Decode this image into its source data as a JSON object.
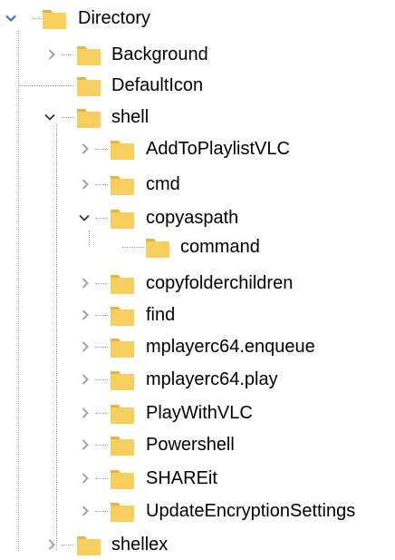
{
  "tree": {
    "nodes": [
      {
        "label": "Directory",
        "state": "expanded",
        "icon": "folder-icon"
      },
      {
        "label": "Background",
        "state": "collapsed",
        "icon": "folder-icon"
      },
      {
        "label": "DefaultIcon",
        "state": "leaf",
        "icon": "folder-icon"
      },
      {
        "label": "shell",
        "state": "expanded",
        "icon": "folder-icon"
      },
      {
        "label": "AddToPlaylistVLC",
        "state": "collapsed",
        "icon": "folder-icon"
      },
      {
        "label": "cmd",
        "state": "collapsed",
        "icon": "folder-icon"
      },
      {
        "label": "copyaspath",
        "state": "expanded",
        "icon": "folder-icon"
      },
      {
        "label": "command",
        "state": "leaf",
        "icon": "folder-icon"
      },
      {
        "label": "copyfolderchildren",
        "state": "collapsed",
        "icon": "folder-icon"
      },
      {
        "label": "find",
        "state": "collapsed",
        "icon": "folder-icon"
      },
      {
        "label": "mplayerc64.enqueue",
        "state": "collapsed",
        "icon": "folder-icon"
      },
      {
        "label": "mplayerc64.play",
        "state": "collapsed",
        "icon": "folder-icon"
      },
      {
        "label": "PlayWithVLC",
        "state": "collapsed",
        "icon": "folder-icon"
      },
      {
        "label": "Powershell",
        "state": "collapsed",
        "icon": "folder-icon"
      },
      {
        "label": "SHAREit",
        "state": "collapsed",
        "icon": "folder-icon"
      },
      {
        "label": "UpdateEncryptionSettings",
        "state": "collapsed",
        "icon": "folder-icon"
      },
      {
        "label": "shellex",
        "state": "collapsed",
        "icon": "folder-icon"
      }
    ]
  },
  "colors": {
    "folder_body": "#f6cf5e",
    "folder_tab": "#e6b43c",
    "chevron_collapsed": "#9a9a9a",
    "chevron_expanded": "#333333",
    "chevron_root": "#1a73d9",
    "tree_line": "#a0a0a0"
  }
}
